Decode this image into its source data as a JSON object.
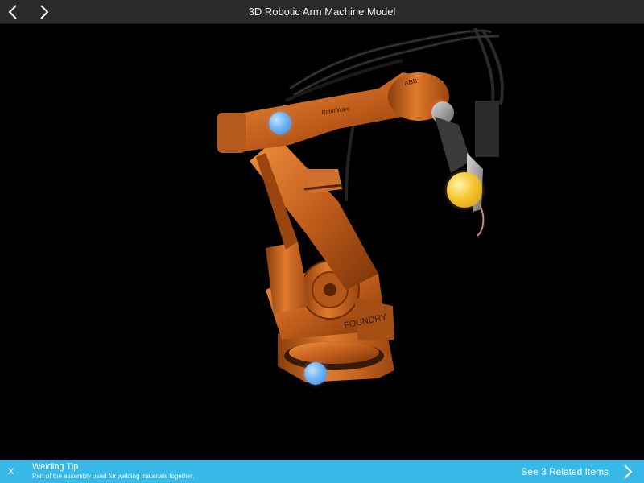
{
  "header": {
    "title": "3D Robotic Arm Machine Model",
    "back_icon": "chevron-left-icon",
    "forward_icon": "chevron-right-icon"
  },
  "hotspots": [
    {
      "name": "shoulder-hotspot",
      "color": "#5aa6ee"
    },
    {
      "name": "base-hotspot",
      "color": "#5aa6ee"
    },
    {
      "name": "welding-tip-hotspot",
      "color": "#f5c531",
      "selected": true
    }
  ],
  "robot": {
    "arm_label": "RobotWare",
    "brand_label": "ABB",
    "base_label": "FOUNDRY",
    "body_color": "#c25e1c"
  },
  "info": {
    "close_label": "X",
    "title": "Welding Tip",
    "description": "Part of the assembly used for welding materials together.",
    "related_label": "See 3 Related Items",
    "accent": "#38b8e6"
  }
}
